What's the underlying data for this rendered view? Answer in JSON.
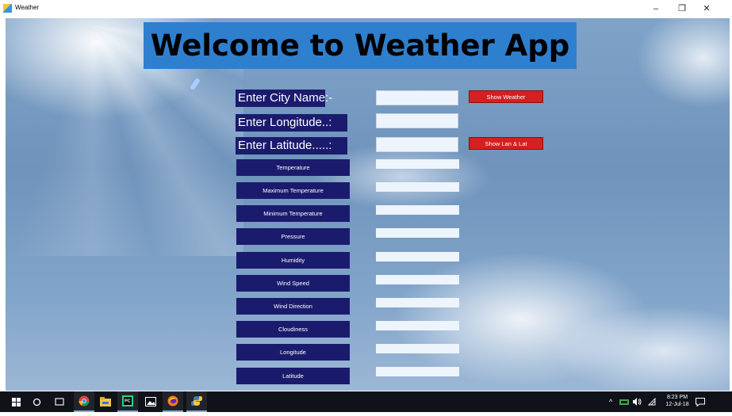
{
  "window": {
    "title": "Weather",
    "min_glyph": "–",
    "max_glyph": "❐",
    "close_glyph": "✕"
  },
  "banner": {
    "text": "Welcome to Weather App"
  },
  "inputs": [
    {
      "label": "Enter City Name:-",
      "value": ""
    },
    {
      "label": "Enter Longitude..:",
      "value": ""
    },
    {
      "label": "Enter Latitude.....:",
      "value": ""
    }
  ],
  "buttons": {
    "show_weather": "Show Weather",
    "show_lan_lat": "Show Lan & Lat"
  },
  "info_fields": [
    {
      "label": "Temperature",
      "value": ""
    },
    {
      "label": "Maximum Temperature",
      "value": ""
    },
    {
      "label": "Minimum Temperature",
      "value": ""
    },
    {
      "label": "Pressure",
      "value": ""
    },
    {
      "label": "Humidity",
      "value": ""
    },
    {
      "label": "Wind Speed",
      "value": ""
    },
    {
      "label": "Wind Direction",
      "value": ""
    },
    {
      "label": "Cloudiness",
      "value": ""
    },
    {
      "label": "Longitude",
      "value": ""
    },
    {
      "label": "Latitude",
      "value": ""
    }
  ],
  "taskbar": {
    "icons": [
      "windows-start-icon",
      "search-circle-icon",
      "task-view-icon",
      "chrome-icon",
      "file-explorer-icon",
      "pycharm-icon",
      "photos-icon",
      "firefox-icon",
      "python-icon"
    ],
    "pycharm_text": "PC",
    "time": "8:23 PM",
    "date": "12-Jul-18"
  },
  "colors": {
    "banner_bg": "#2f7fcf",
    "label_bg": "#1b1b6e",
    "button_red": "#d61f1f",
    "taskbar_bg": "#0f1218"
  }
}
